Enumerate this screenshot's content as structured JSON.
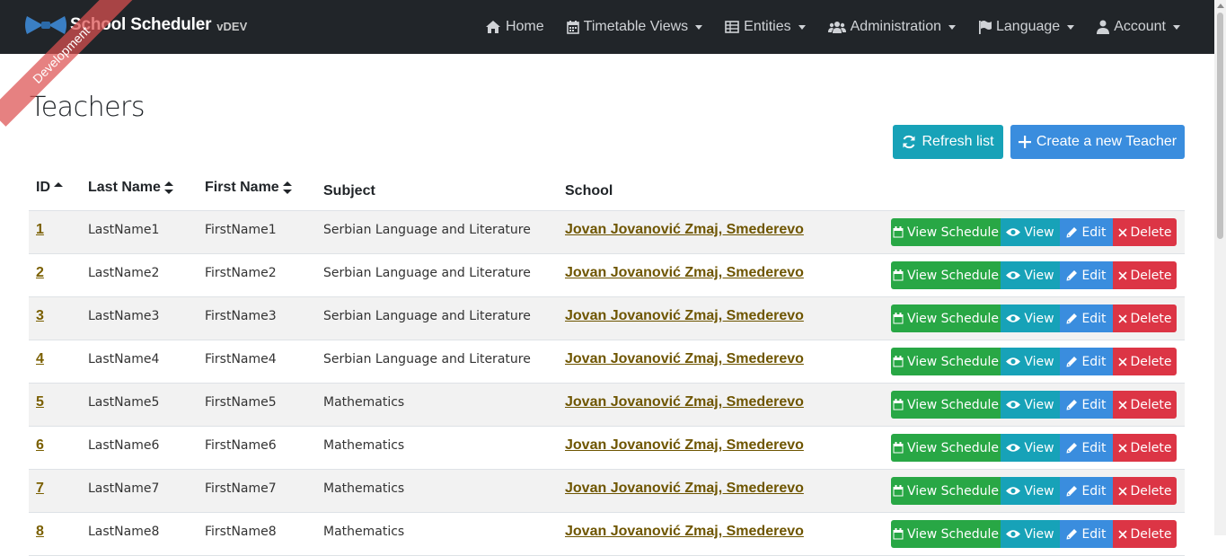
{
  "brand": {
    "name": "School Scheduler",
    "version": "vDEV",
    "ribbon": "Development"
  },
  "nav": [
    {
      "label": "Home",
      "icon": "home-icon",
      "dropdown": false
    },
    {
      "label": "Timetable Views",
      "icon": "calendar-icon",
      "dropdown": true
    },
    {
      "label": "Entities",
      "icon": "table-icon",
      "dropdown": true
    },
    {
      "label": "Administration",
      "icon": "users-icon",
      "dropdown": true
    },
    {
      "label": "Language",
      "icon": "flag-icon",
      "dropdown": true
    },
    {
      "label": "Account",
      "icon": "user-icon",
      "dropdown": true
    }
  ],
  "page": {
    "title": "Teachers",
    "refresh_label": "Refresh list",
    "create_label": "Create a new Teacher"
  },
  "table": {
    "headers": {
      "id": "ID",
      "last": "Last Name",
      "first": "First Name",
      "subject": "Subject",
      "school": "School"
    },
    "actions": {
      "schedule": "View Schedule",
      "view": "View",
      "edit": "Edit",
      "delete": "Delete"
    },
    "rows": [
      {
        "id": "1",
        "last": "LastName1",
        "first": "FirstName1",
        "subject": "Serbian Language and Literature",
        "school": "Jovan Jovanović Zmaj, Smederevo"
      },
      {
        "id": "2",
        "last": "LastName2",
        "first": "FirstName2",
        "subject": "Serbian Language and Literature",
        "school": "Jovan Jovanović Zmaj, Smederevo"
      },
      {
        "id": "3",
        "last": "LastName3",
        "first": "FirstName3",
        "subject": "Serbian Language and Literature",
        "school": "Jovan Jovanović Zmaj, Smederevo"
      },
      {
        "id": "4",
        "last": "LastName4",
        "first": "FirstName4",
        "subject": "Serbian Language and Literature",
        "school": "Jovan Jovanović Zmaj, Smederevo"
      },
      {
        "id": "5",
        "last": "LastName5",
        "first": "FirstName5",
        "subject": "Mathematics",
        "school": "Jovan Jovanović Zmaj, Smederevo"
      },
      {
        "id": "6",
        "last": "LastName6",
        "first": "FirstName6",
        "subject": "Mathematics",
        "school": "Jovan Jovanović Zmaj, Smederevo"
      },
      {
        "id": "7",
        "last": "LastName7",
        "first": "FirstName7",
        "subject": "Mathematics",
        "school": "Jovan Jovanović Zmaj, Smederevo"
      },
      {
        "id": "8",
        "last": "LastName8",
        "first": "FirstName8",
        "subject": "Mathematics",
        "school": "Jovan Jovanović Zmaj, Smederevo"
      }
    ]
  },
  "colors": {
    "navbar": "#212529",
    "success": "#28a745",
    "info": "#17a2b8",
    "primary": "#3a8dde",
    "danger": "#dc3545",
    "link": "#6e5500"
  }
}
